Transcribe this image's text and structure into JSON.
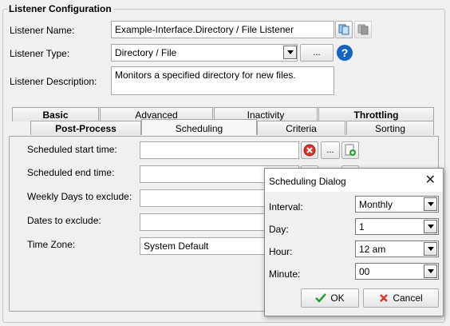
{
  "group_title": "Listener Configuration",
  "fields": {
    "name_label": "Listener Name:",
    "name_value": "Example-Interface.Directory / File Listener",
    "type_label": "Listener Type:",
    "type_value": "Directory / File",
    "type_button": "...",
    "help_icon": "?",
    "desc_label": "Listener Description:",
    "desc_value": "Monitors a specified directory for new files."
  },
  "tabs": {
    "row1": [
      "Basic",
      "Advanced",
      "Inactivity",
      "Throttling"
    ],
    "row2": [
      "Post-Process",
      "Scheduling",
      "Criteria",
      "Sorting"
    ],
    "active": "Scheduling"
  },
  "scheduling": {
    "start_label": "Scheduled start time:",
    "end_label": "Scheduled end time:",
    "weekly_label": "Weekly Days to exclude:",
    "dates_label": "Dates to exclude:",
    "tz_label": "Time Zone:",
    "tz_value": "System Default",
    "ellipsis": "..."
  },
  "dialog": {
    "title": "Scheduling Dialog",
    "close": "✕",
    "interval_label": "Interval:",
    "interval_value": "Monthly",
    "day_label": "Day:",
    "day_value": "1",
    "hour_label": "Hour:",
    "hour_value": "12 am",
    "minute_label": "Minute:",
    "minute_value": "00",
    "ok_label": "OK",
    "cancel_label": "Cancel"
  },
  "colors": {
    "help_blue": "#1565c0",
    "remove_red": "#d9332b",
    "ok_green": "#2e9e3c",
    "cancel_red": "#e03a2e"
  }
}
